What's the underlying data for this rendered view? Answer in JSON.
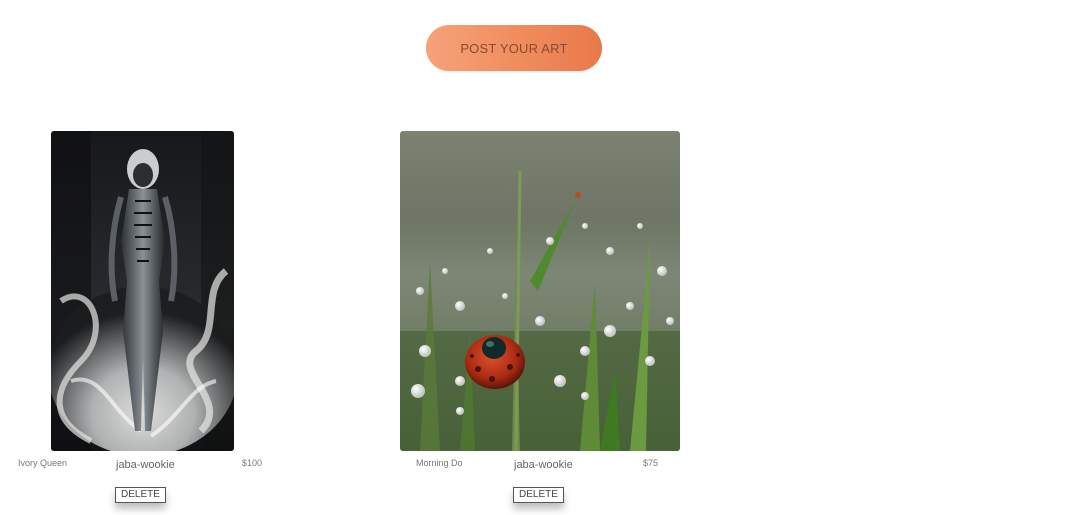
{
  "header": {
    "post_button_label": "POST YOUR ART"
  },
  "artworks": [
    {
      "title": "Ivory Queen",
      "artist": "jaba-wookie",
      "price": "$100",
      "delete_label": "DELETE",
      "image_icon": "alien-figure-image"
    },
    {
      "title": "Morning Do",
      "artist": "jaba-wookie",
      "price": "$75",
      "delete_label": "DELETE",
      "image_icon": "ladybug-dew-grass-image"
    }
  ],
  "colors": {
    "button_start": "#f6a27a",
    "button_end": "#e8784a"
  }
}
